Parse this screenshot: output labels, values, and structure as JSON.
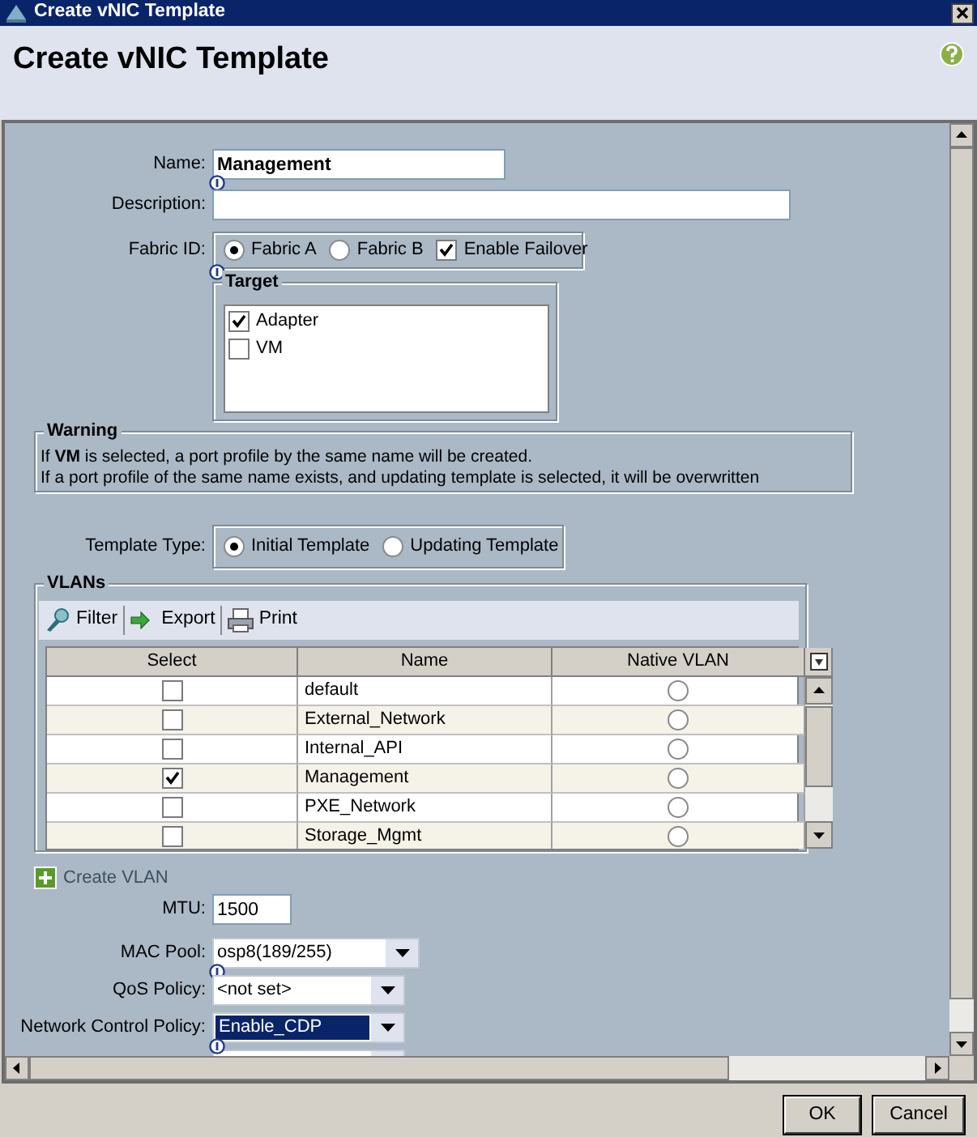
{
  "window": {
    "title": "Create vNIC Template"
  },
  "header": {
    "title": "Create vNIC Template"
  },
  "form": {
    "name": {
      "label": "Name:",
      "value": "Management",
      "info": true
    },
    "description": {
      "label": "Description:",
      "info": false
    },
    "fabric_id": {
      "label": "Fabric ID:",
      "info": true,
      "options": [
        {
          "label": "Fabric A",
          "selected": true
        },
        {
          "label": "Fabric B",
          "selected": false
        }
      ],
      "failover": {
        "label": "Enable Failover",
        "checked": true
      }
    },
    "target": {
      "title": "Target",
      "items": [
        {
          "label": "Adapter",
          "checked": true
        },
        {
          "label": "VM",
          "checked": false
        }
      ]
    },
    "warning": {
      "title": "Warning",
      "lines": [
        "If **VM** is selected, a port profile by the same name will be created.",
        "If a port profile of the same name exists, and updating template is selected, it will be overwritten"
      ]
    },
    "template_type": {
      "label": "Template Type:",
      "options": [
        {
          "label": "Initial Template",
          "selected": true
        },
        {
          "label": "Updating Template",
          "selected": false
        }
      ]
    },
    "vlans": {
      "title": "VLANs",
      "toolbar": [
        {
          "kind": "filter",
          "label": "Filter"
        },
        {
          "kind": "export",
          "label": "Export"
        },
        {
          "kind": "print",
          "label": "Print"
        }
      ],
      "columns": [
        "Select",
        "Name",
        "Native VLAN"
      ],
      "rows": [
        {
          "checked": false,
          "name": "default",
          "native": false
        },
        {
          "checked": false,
          "name": "External_Network",
          "native": false
        },
        {
          "checked": false,
          "name": "Internal_API",
          "native": false
        },
        {
          "checked": true,
          "name": "Management",
          "native": false
        },
        {
          "checked": false,
          "name": "PXE_Network",
          "native": false
        },
        {
          "checked": false,
          "name": "Storage_Mgmt",
          "native": false
        }
      ]
    },
    "create_vlan": {
      "label": "Create VLAN"
    },
    "mtu": {
      "label": "MTU:",
      "value": "1500",
      "info": false
    },
    "dropdowns": [
      {
        "label": "MAC Pool:",
        "value": "osp8(189/255)",
        "info": true,
        "focused": false
      },
      {
        "label": "QoS Policy:",
        "value": "<not set>",
        "info": false,
        "focused": false
      },
      {
        "label": "Network Control Policy:",
        "value": "Enable_CDP",
        "info": true,
        "focused": true
      }
    ]
  },
  "buttons": [
    {
      "label": "OK"
    },
    {
      "label": "Cancel"
    }
  ]
}
